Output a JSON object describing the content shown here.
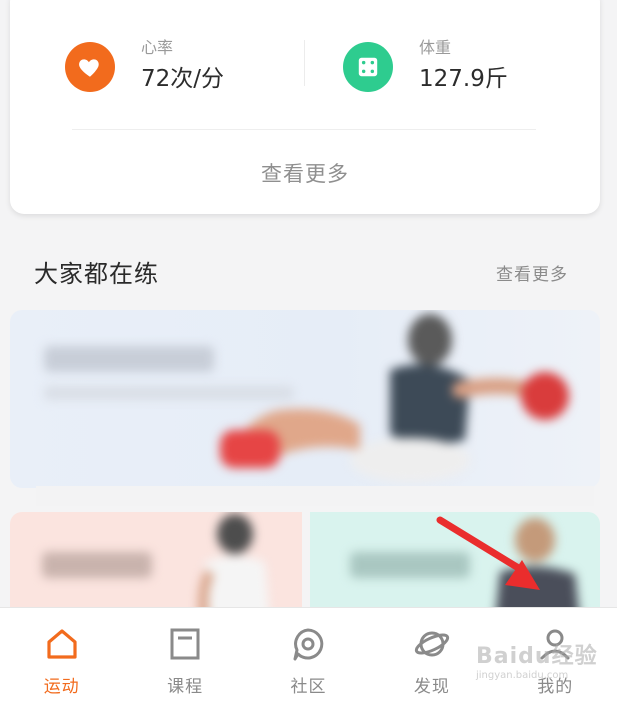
{
  "stats": {
    "heart_rate": {
      "label": "心率",
      "value": "72次/分",
      "icon": "heart-icon",
      "color": "#f26b1d"
    },
    "weight": {
      "label": "体重",
      "value": "127.9斤",
      "icon": "scale-icon",
      "color": "#2ecc8f"
    },
    "more_label": "查看更多"
  },
  "section": {
    "title": "大家都在练",
    "more_label": "查看更多"
  },
  "tabbar": {
    "active_color": "#f26b1d",
    "inactive_color": "#8a8a8a",
    "tabs": [
      {
        "label": "运动",
        "icon": "home-icon",
        "active": true
      },
      {
        "label": "课程",
        "icon": "course-icon",
        "active": false
      },
      {
        "label": "社区",
        "icon": "community-icon",
        "active": false
      },
      {
        "label": "发现",
        "icon": "planet-icon",
        "active": false
      },
      {
        "label": "我的",
        "icon": "profile-icon",
        "active": false
      }
    ]
  },
  "watermark": {
    "main": "Baidu经验",
    "sub": "jingyan.baidu.com"
  }
}
